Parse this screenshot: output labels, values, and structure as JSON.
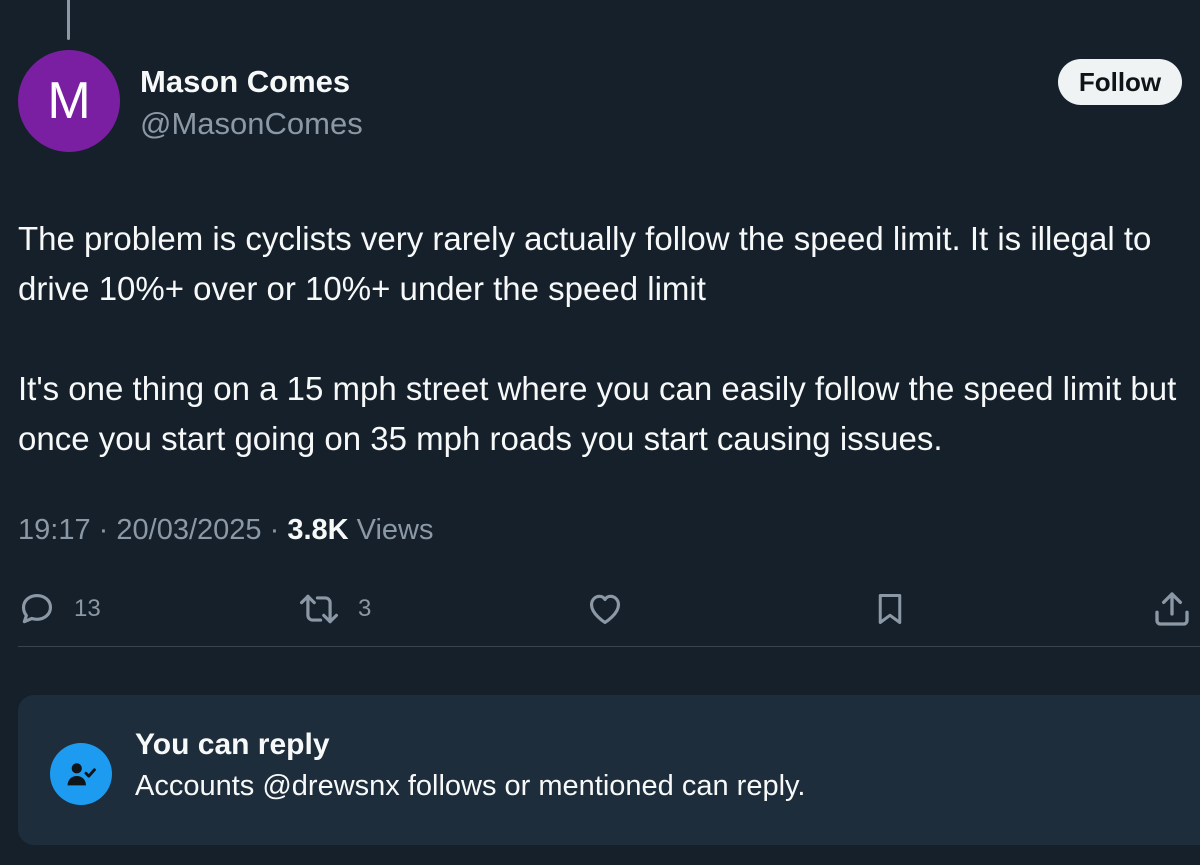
{
  "author": {
    "avatar_letter": "M",
    "avatar_color": "#7b1fa2",
    "display_name": "Mason Comes",
    "handle": "@MasonComes"
  },
  "follow_label": "Follow",
  "tweet": {
    "paragraphs": [
      "The problem is cyclists very rarely actually follow the speed limit. It is illegal to drive 10%+ over or 10%+ under the speed limit",
      "It's one thing on a 15 mph street where you can easily follow the speed limit but once you start going on 35 mph roads you start causing issues."
    ],
    "time": "19:17",
    "separator": "·",
    "date": "20/03/2025",
    "views_count": "3.8K",
    "views_label": "Views"
  },
  "actions": {
    "reply": {
      "icon": "reply-icon",
      "count": "13"
    },
    "retweet": {
      "icon": "retweet-icon",
      "count": "3"
    },
    "like": {
      "icon": "heart-icon"
    },
    "bookmark": {
      "icon": "bookmark-icon"
    },
    "share": {
      "icon": "share-icon"
    }
  },
  "reply_restriction": {
    "icon": "person-check-icon",
    "title": "You can reply",
    "description": "Accounts @drewsnx follows or mentioned can reply."
  },
  "colors": {
    "background": "#15202b",
    "text_primary": "#f7f9f9",
    "text_secondary": "#8b98a5",
    "accent": "#1d9bf0",
    "reply_box": "#1e2d3b"
  }
}
